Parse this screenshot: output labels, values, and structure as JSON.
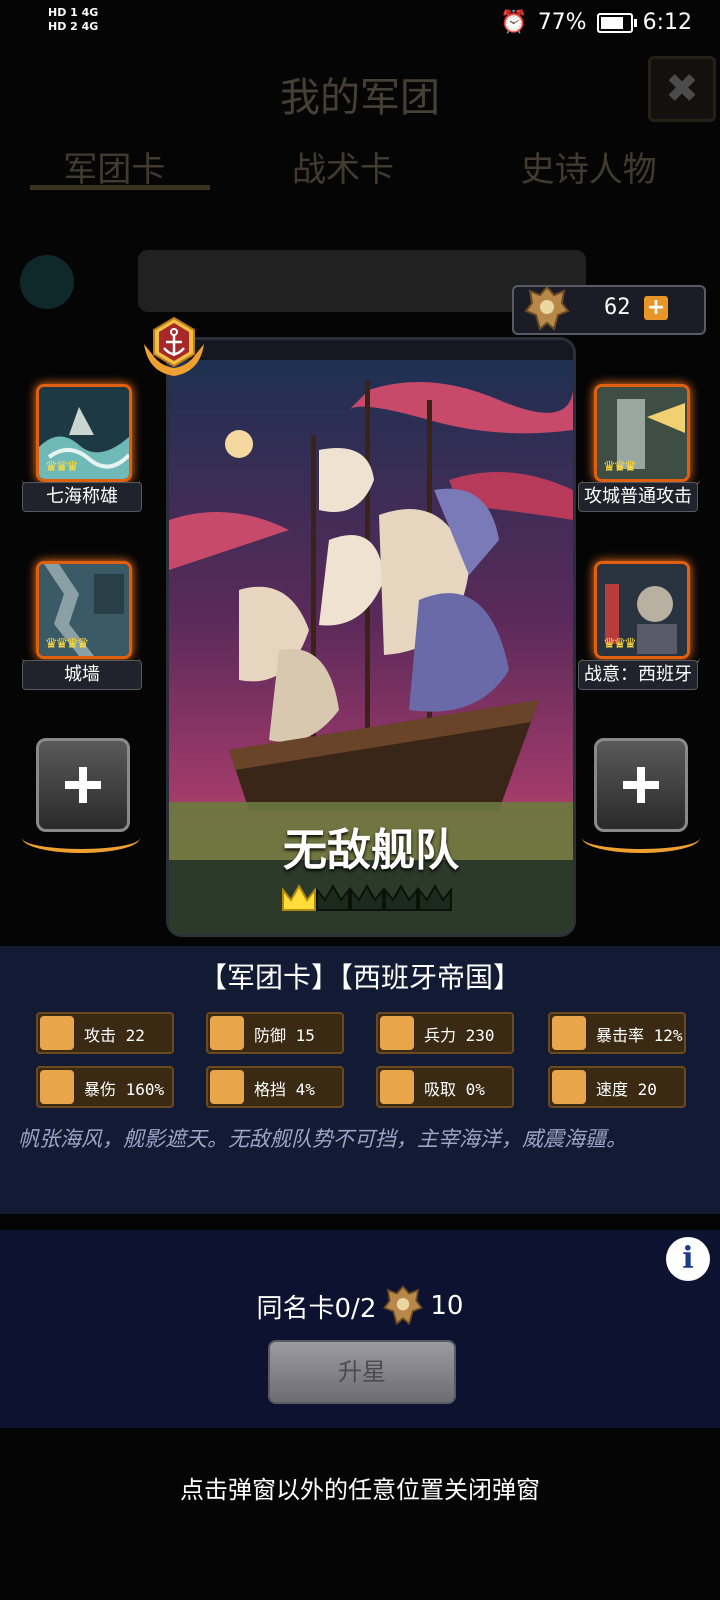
{
  "status_bar": {
    "network": [
      "HD 1 4G",
      "HD 2 4G"
    ],
    "battery": "77%",
    "time": "6:12",
    "alarm_icon": "alarm-icon"
  },
  "background": {
    "title": "我的军团",
    "tabs": [
      "军团卡",
      "战术卡",
      "史诗人物"
    ]
  },
  "currency": {
    "value": "62",
    "add": "+"
  },
  "left_slots": [
    {
      "name": "七海称雄",
      "stars": 3
    },
    {
      "name": "城墙",
      "stars": 4
    }
  ],
  "right_slots": [
    {
      "name": "攻城普通攻击",
      "stars": 3
    },
    {
      "name": "战意：西班牙",
      "stars": 3
    }
  ],
  "card": {
    "name": "无敌舰队",
    "stars_filled": 1,
    "stars_total": 5
  },
  "panel": {
    "tags": "【军团卡】【西班牙帝国】",
    "stats": [
      {
        "label": "攻击 22",
        "icon": "sword-icon"
      },
      {
        "label": "防御 15",
        "icon": "shield-icon"
      },
      {
        "label": "兵力 230",
        "icon": "heart-icon"
      },
      {
        "label": "暴击率 12%",
        "icon": "crit-icon"
      },
      {
        "label": "暴伤 160%",
        "icon": "burst-icon"
      },
      {
        "label": "格挡 4%",
        "icon": "block-icon"
      },
      {
        "label": "吸取 0%",
        "icon": "drain-icon"
      },
      {
        "label": "速度 20",
        "icon": "boot-icon"
      }
    ],
    "description": "帆张海风，舰影遮天。无敌舰队势不可挡，主宰海洋，威震海疆。"
  },
  "upgrade": {
    "dup_label": "同名卡0/2",
    "cost": "10",
    "button": "升星"
  },
  "close_hint": "点击弹窗以外的任意位置关闭弹窗",
  "colors": {
    "accent_orange": "#e8952a",
    "panel_bg": "#121a34",
    "stat_bg": "#3a2a14"
  }
}
